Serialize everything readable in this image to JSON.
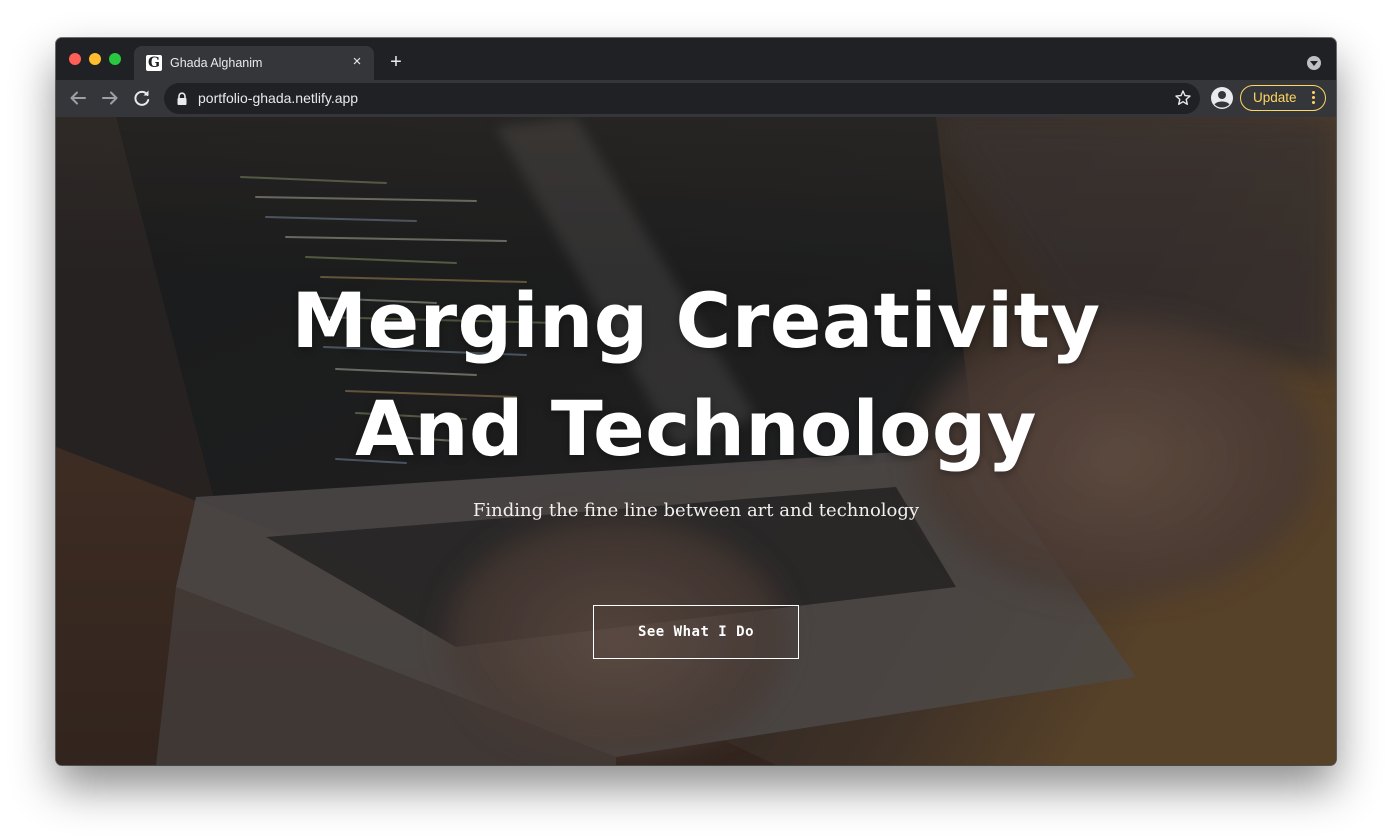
{
  "browser": {
    "tab": {
      "favicon_letter": "G",
      "title": "Ghada Alghanim"
    },
    "new_tab_symbol": "+",
    "close_symbol": "×",
    "address_bar": {
      "url": "portfolio-ghada.netlify.app",
      "secure": true
    },
    "update_button_label": "Update",
    "colors": {
      "chrome_dark": "#202124",
      "chrome_toolbar": "#35363a",
      "update_accent": "#fdd663"
    },
    "icons": [
      "back-arrow-icon",
      "forward-arrow-icon",
      "reload-icon",
      "lock-icon",
      "star-icon",
      "profile-icon",
      "more-vertical-icon",
      "tab-search-icon"
    ]
  },
  "hero": {
    "title": "Merging Creativity And Technology",
    "subtitle": "Finding the fine line between art and technology",
    "cta_label": "See What I Do",
    "background": "photo of hands typing on a laptop showing code"
  }
}
